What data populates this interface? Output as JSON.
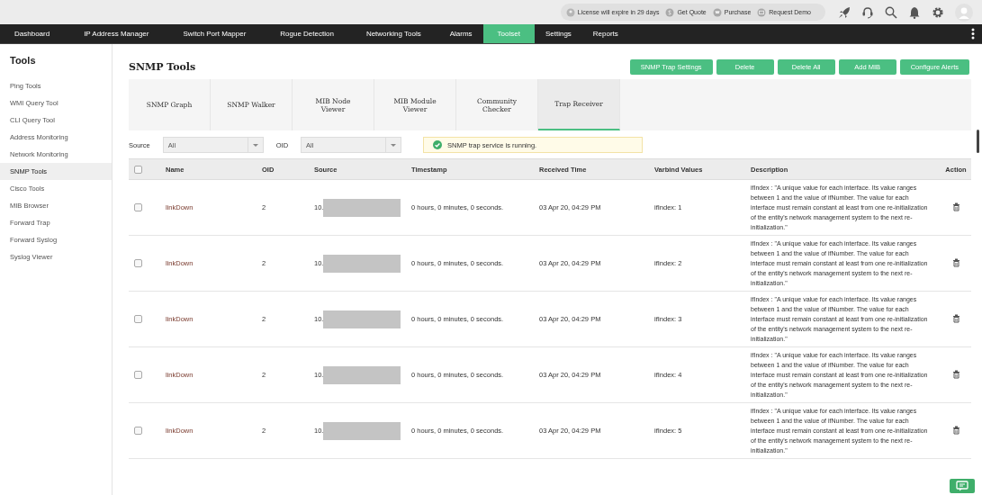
{
  "top_bar": {
    "license": "License will expire in 29 days",
    "links": [
      {
        "label": "Get Quote"
      },
      {
        "label": "Purchase"
      },
      {
        "label": "Request Demo"
      }
    ]
  },
  "nav": [
    {
      "label": "Dashboard",
      "selected": false
    },
    {
      "label": "IP Address Manager",
      "selected": false
    },
    {
      "label": "Switch Port Mapper",
      "selected": false
    },
    {
      "label": "Rogue Detection",
      "selected": false
    },
    {
      "label": "Networking Tools",
      "selected": false
    },
    {
      "label": "Alarms",
      "selected": false
    },
    {
      "label": "Toolset",
      "selected": true
    },
    {
      "label": "Settings",
      "selected": false
    },
    {
      "label": "Reports",
      "selected": false
    }
  ],
  "sidebar": {
    "title": "Tools",
    "items": [
      {
        "label": "Ping Tools",
        "selected": false
      },
      {
        "label": "WMI Query Tool",
        "selected": false
      },
      {
        "label": "CLI Query Tool",
        "selected": false
      },
      {
        "label": "Address Monitoring",
        "selected": false
      },
      {
        "label": "Network Monitoring",
        "selected": false
      },
      {
        "label": "SNMP Tools",
        "selected": true
      },
      {
        "label": "Cisco Tools",
        "selected": false
      },
      {
        "label": "MIB Browser",
        "selected": false
      },
      {
        "label": "Forward Trap",
        "selected": false
      },
      {
        "label": "Forward Syslog",
        "selected": false
      },
      {
        "label": "Syslog Viewer",
        "selected": false
      }
    ]
  },
  "page": {
    "title": "SNMP Tools",
    "buttons": [
      "SNMP Trap Settings",
      "Delete",
      "Delete All",
      "Add MIB",
      "Configure Alerts"
    ]
  },
  "tabs": [
    {
      "label": "SNMP Graph",
      "selected": false
    },
    {
      "label": "SNMP Walker",
      "selected": false
    },
    {
      "label": "MIB Node Viewer",
      "selected": false
    },
    {
      "label": "MIB Module Viewer",
      "selected": false
    },
    {
      "label": "Community Checker",
      "selected": false
    },
    {
      "label": "Trap Receiver",
      "selected": true
    }
  ],
  "filters": [
    {
      "label": "Source",
      "value": "All"
    },
    {
      "label": "OID",
      "value": "All"
    }
  ],
  "status_message": "SNMP trap service is running.",
  "table": {
    "select_all_checked": false,
    "columns": [
      "Name",
      "OID",
      "Source",
      "Timestamp",
      "Received Time",
      "Varbind Values",
      "Description",
      "Action"
    ],
    "rows": [
      {
        "checked": false,
        "name": "linkDown",
        "oid": "2",
        "source": "10.",
        "timestamp": "0 hours, 0 minutes, 0 seconds.",
        "received": "03 Apr 20, 04:29 PM",
        "varbind": "ifIndex: 1",
        "description": "ifIndex : \"A unique value for each interface. Its value ranges between 1 and the value of ifNumber. The value for each interface must remain constant at least from one re-initialization of the entity's network management system to the next re- initialization.\""
      },
      {
        "checked": false,
        "name": "linkDown",
        "oid": "2",
        "source": "10.",
        "timestamp": "0 hours, 0 minutes, 0 seconds.",
        "received": "03 Apr 20, 04:29 PM",
        "varbind": "ifIndex: 2",
        "description": "ifIndex : \"A unique value for each interface. Its value ranges between 1 and the value of ifNumber. The value for each interface must remain constant at least from one re-initialization of the entity's network management system to the next re- initialization.\""
      },
      {
        "checked": false,
        "name": "linkDown",
        "oid": "2",
        "source": "10.",
        "timestamp": "0 hours, 0 minutes, 0 seconds.",
        "received": "03 Apr 20, 04:29 PM",
        "varbind": "ifIndex: 3",
        "description": "ifIndex : \"A unique value for each interface. Its value ranges between 1 and the value of ifNumber. The value for each interface must remain constant at least from one re-initialization of the entity's network management system to the next re- initialization.\""
      },
      {
        "checked": false,
        "name": "linkDown",
        "oid": "2",
        "source": "10.",
        "timestamp": "0 hours, 0 minutes, 0 seconds.",
        "received": "03 Apr 20, 04:29 PM",
        "varbind": "ifIndex: 4",
        "description": "ifIndex : \"A unique value for each interface. Its value ranges between 1 and the value of ifNumber. The value for each interface must remain constant at least from one re-initialization of the entity's network management system to the next re- initialization.\""
      },
      {
        "checked": false,
        "name": "linkDown",
        "oid": "2",
        "source": "10.",
        "timestamp": "0 hours, 0 minutes, 0 seconds.",
        "received": "03 Apr 20, 04:29 PM",
        "varbind": "ifIndex: 5",
        "description": "ifIndex : \"A unique value for each interface. Its value ranges between 1 and the value of ifNumber. The value for each interface must remain constant at least from one re-initialization of the entity's network management system to the next re- initialization.\""
      }
    ]
  }
}
